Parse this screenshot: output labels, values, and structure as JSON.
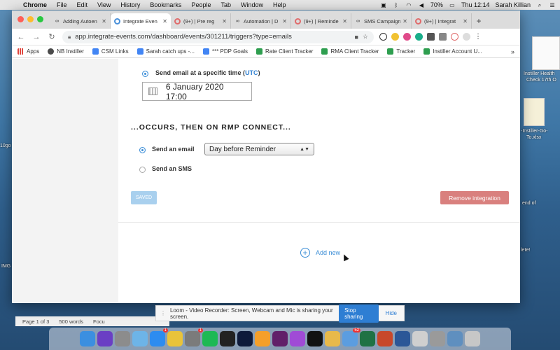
{
  "menubar": {
    "app_name": "Chrome",
    "items": [
      "File",
      "Edit",
      "View",
      "History",
      "Bookmarks",
      "People",
      "Tab",
      "Window",
      "Help"
    ],
    "battery": "70%",
    "clock": "Thu 12:14",
    "user": "Sarah Killian"
  },
  "browser": {
    "tabs": [
      {
        "label": "Adding Autoen",
        "color": "#5b6f8a",
        "active": false
      },
      {
        "label": "Integrate Even",
        "color": "#4a90d9",
        "active": true
      },
      {
        "label": "(9+) | Pre reg",
        "color": "#e06b6b",
        "active": false
      },
      {
        "label": "Automation | D",
        "color": "#5b6f8a",
        "active": false
      },
      {
        "label": "(9+) | Reminde",
        "color": "#e06b6b",
        "active": false
      },
      {
        "label": "SMS Campaign",
        "color": "#5b6f8a",
        "active": false
      },
      {
        "label": "(9+) | Integrat",
        "color": "#e06b6b",
        "active": false
      }
    ],
    "url": "app.integrate-events.com/dashboard/events/301211/triggers?type=emails",
    "bookmarks": [
      {
        "label": "Apps",
        "color": "#e0463e"
      },
      {
        "label": "NB Instiller",
        "color": "#4a4a4a"
      },
      {
        "label": "CSM Links",
        "color": "#4285f4"
      },
      {
        "label": "Sarah catch ups -...",
        "color": "#4285f4"
      },
      {
        "label": "*** PDP Goals",
        "color": "#4285f4"
      },
      {
        "label": "Rate Client Tracker",
        "color": "#2e9e4f"
      },
      {
        "label": "RMA Client Tracker",
        "color": "#2e9e4f"
      },
      {
        "label": "Tracker",
        "color": "#2e9e4f"
      },
      {
        "label": "Instiller Account U...",
        "color": "#2e9e4f"
      }
    ],
    "bookmarks_more": "»"
  },
  "page": {
    "send_specific_prefix": "Send email at a specific time (",
    "send_specific_tz": "UTC",
    "send_specific_suffix": ")",
    "date_value": "6 January 2020 17:00",
    "section_heading": "...OCCURS, THEN ON RMP CONNECT...",
    "send_email_label": "Send an email",
    "email_select_value": "Day before Reminder",
    "send_sms_label": "Send an SMS",
    "saved_button": "SAVED",
    "remove_button": "Remove integration",
    "add_new": "Add new"
  },
  "desktop": {
    "right_labels": [
      "Instiller Health",
      "Check 17th O",
      "-Instiller-Go-",
      "To.xlsx",
      "end of",
      "lete!"
    ],
    "left_labels": [
      "10go",
      "IMG"
    ]
  },
  "word_status": {
    "page": "Page 1 of 3",
    "words": "500 words",
    "focus": "Focu"
  },
  "loom": {
    "message": "Loom - Video Recorder: Screen, Webcam and Mic is sharing your screen.",
    "stop": "Stop sharing",
    "hide": "Hide"
  },
  "dock": {
    "apps": [
      {
        "name": "finder",
        "color": "#3b8fe0"
      },
      {
        "name": "siri",
        "color": "#6a3fc4"
      },
      {
        "name": "launchpad",
        "color": "#8c8c8c"
      },
      {
        "name": "preview",
        "color": "#6db4e8"
      },
      {
        "name": "app-store",
        "color": "#2d8cf0",
        "badge": "1"
      },
      {
        "name": "chrome",
        "color": "#e9c33a"
      },
      {
        "name": "system-preferences",
        "color": "#7b7b7b",
        "badge": "1"
      },
      {
        "name": "spotify",
        "color": "#1db954"
      },
      {
        "name": "terminal",
        "color": "#222222"
      },
      {
        "name": "photoshop",
        "color": "#0e1a3a"
      },
      {
        "name": "sublime",
        "color": "#f59f2a"
      },
      {
        "name": "slack",
        "color": "#611f69"
      },
      {
        "name": "podcasts",
        "color": "#a04bd6"
      },
      {
        "name": "tv",
        "color": "#111111"
      },
      {
        "name": "photos",
        "color": "#e8b94a"
      },
      {
        "name": "mail",
        "color": "#5b9de0",
        "badge": "52"
      },
      {
        "name": "excel",
        "color": "#1f7244"
      },
      {
        "name": "powerpoint",
        "color": "#c8482a"
      },
      {
        "name": "word",
        "color": "#2b5797"
      },
      {
        "name": "notes",
        "color": "#cfcfcf"
      },
      {
        "name": "screenshot",
        "color": "#9a9a9a"
      },
      {
        "name": "folder",
        "color": "#5f8fbf"
      },
      {
        "name": "trash",
        "color": "#c7c7c7"
      }
    ]
  }
}
